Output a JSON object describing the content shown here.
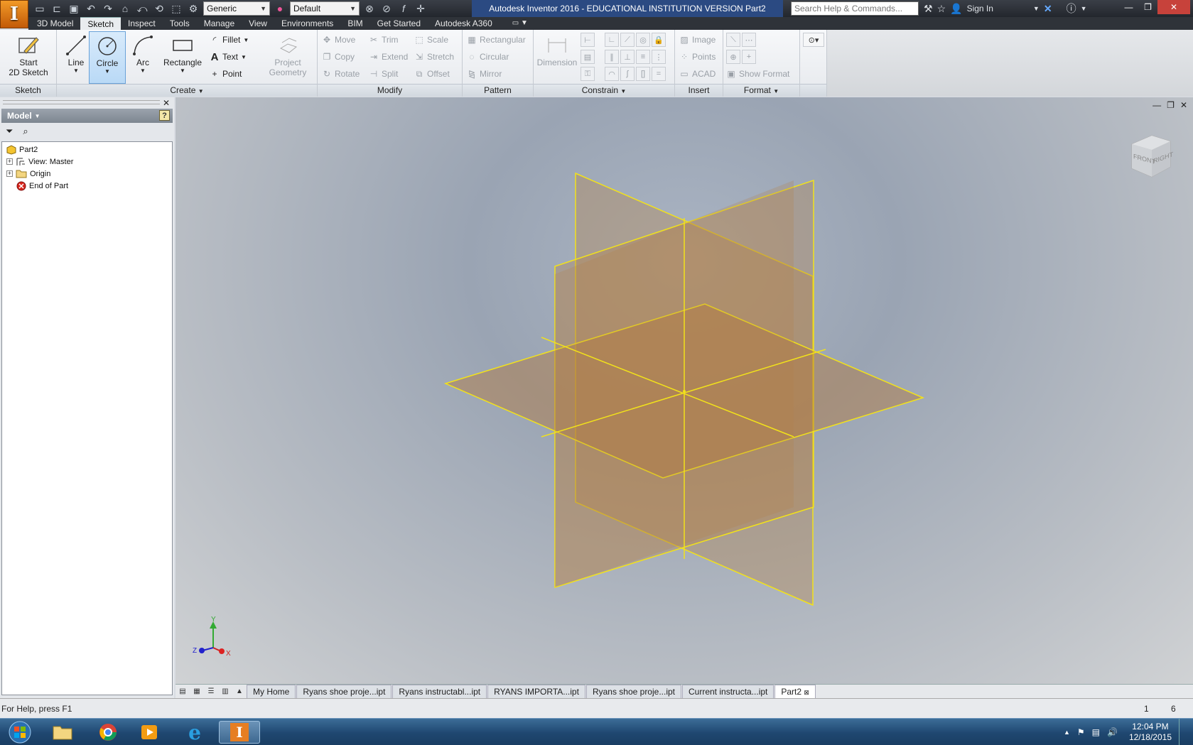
{
  "window": {
    "title": "Autodesk Inventor 2016 - EDUCATIONAL INSTITUTION VERSION    Part2",
    "app_letter": "I",
    "search_placeholder": "Search Help & Commands...",
    "sign_in": "Sign In",
    "material_combo": "Generic",
    "appearance_combo": "Default"
  },
  "ribbon_tabs": [
    "3D Model",
    "Sketch",
    "Inspect",
    "Tools",
    "Manage",
    "View",
    "Environments",
    "BIM",
    "Get Started",
    "Autodesk A360"
  ],
  "active_tab": "Sketch",
  "ribbon": {
    "sketch_panel": {
      "label": "Sketch",
      "start_line1": "Start",
      "start_line2": "2D Sketch"
    },
    "create_panel": {
      "label": "Create",
      "line": "Line",
      "circle": "Circle",
      "arc": "Arc",
      "rectangle": "Rectangle",
      "fillet": "Fillet",
      "text": "Text",
      "point": "Point",
      "project_line1": "Project",
      "project_line2": "Geometry"
    },
    "modify_panel": {
      "label": "Modify",
      "move": "Move",
      "trim": "Trim",
      "scale": "Scale",
      "copy": "Copy",
      "extend": "Extend",
      "stretch": "Stretch",
      "rotate": "Rotate",
      "split": "Split",
      "offset": "Offset"
    },
    "pattern_panel": {
      "label": "Pattern",
      "rectangular": "Rectangular",
      "circular": "Circular",
      "mirror": "Mirror"
    },
    "constrain_panel": {
      "label": "Constrain",
      "dimension": "Dimension"
    },
    "insert_panel": {
      "label": "Insert",
      "image": "Image",
      "points": "Points",
      "acad": "ACAD"
    },
    "format_panel": {
      "label": "Format",
      "show_format": "Show Format"
    }
  },
  "browser": {
    "header": "Model",
    "tree": {
      "root": "Part2",
      "view": "View: Master",
      "origin": "Origin",
      "end": "End of Part"
    }
  },
  "viewcube": {
    "front": "FRONT",
    "right": "RIGHT"
  },
  "triad": {
    "x": "X",
    "y": "Y",
    "z": "Z"
  },
  "document_tabs": [
    "My Home",
    "Ryans shoe proje...ipt",
    "Ryans instructabl...ipt",
    "RYANS IMPORTA...ipt",
    "Ryans shoe proje...ipt",
    "Current instructa...ipt",
    "Part2"
  ],
  "active_document": "Part2",
  "status": {
    "help": "For Help, press F1",
    "count1": "1",
    "count2": "6"
  },
  "taskbar": {
    "time": "12:04 PM",
    "date": "12/18/2015"
  },
  "colors": {
    "plane_stroke": "#f2e21a",
    "plane_fill": "#b37a3c",
    "accent": "#2b4a82"
  }
}
